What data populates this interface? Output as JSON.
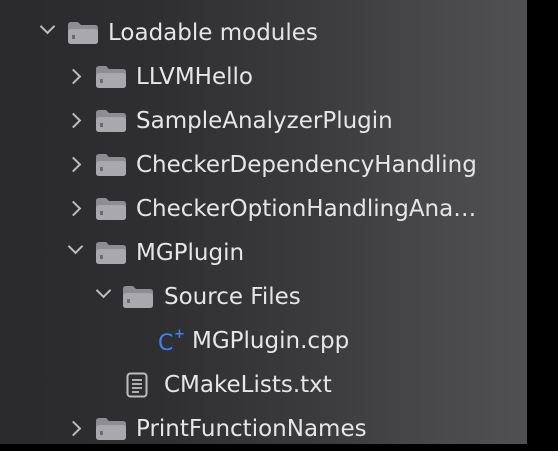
{
  "tree": {
    "root_label": "Loadable modules",
    "items": [
      {
        "label": "LLVMHello"
      },
      {
        "label": "SampleAnalyzerPlugin"
      },
      {
        "label": "CheckerDependencyHandling"
      },
      {
        "label": "CheckerOptionHandlingAnalyzerPlugin"
      },
      {
        "label": "MGPlugin"
      },
      {
        "label": "Source Files"
      },
      {
        "label": "MGPlugin.cpp",
        "type": "C++ source"
      },
      {
        "label": "CMakeLists.txt",
        "type": "text document"
      },
      {
        "label": "PrintFunctionNames"
      }
    ],
    "icons": {
      "folder": "folder-icon",
      "disclosure": "chevron-icon",
      "cpp": "cpp-file-icon",
      "text": "text-file-icon"
    },
    "colors": {
      "accent": "#3b82f6",
      "text": "#e6e6e6"
    }
  }
}
